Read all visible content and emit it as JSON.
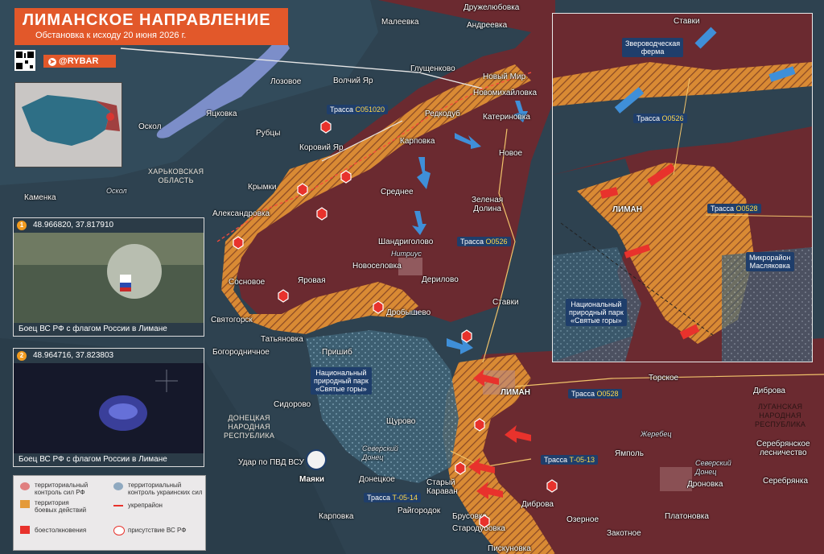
{
  "header": {
    "title": "ЛИМАНСКОЕ НАПРАВЛЕНИЕ",
    "subtitle": "Обстановка к исходу 20 июня 2026 г.",
    "brand": "@RYBAR"
  },
  "colors": {
    "russian_control": "#6b2a30",
    "contested": "#e49a3a",
    "ukrainian_control": "#2f4a5a",
    "river": "#7c8ec9",
    "accent": "#e2582a",
    "road_label_bg": "#1f3e6b",
    "road_code": "#ffd94a"
  },
  "minimap": {
    "city": "Оскол"
  },
  "place_labels": [
    {
      "id": "maleevka",
      "text": "Малеевка"
    },
    {
      "id": "druzhelyubovka",
      "text": "Дружелюбовка"
    },
    {
      "id": "andreevka",
      "text": "Андреевка"
    },
    {
      "id": "glushchenkovo",
      "text": "Глущенково"
    },
    {
      "id": "lozovoe",
      "text": "Лозовое"
    },
    {
      "id": "volchiy-yar",
      "text": "Волчий Яр"
    },
    {
      "id": "novy-mir",
      "text": "Новый Мир"
    },
    {
      "id": "novomikhaylovka",
      "text": "Новомихайловка"
    },
    {
      "id": "yatskovka",
      "text": "Яцковка"
    },
    {
      "id": "oskol",
      "text": "Оскол"
    },
    {
      "id": "rubtsy",
      "text": "Рубцы"
    },
    {
      "id": "redkodub",
      "text": "Редкодуб"
    },
    {
      "id": "katerinovka",
      "text": "Катериновка"
    },
    {
      "id": "karpovka",
      "text": "Карповка"
    },
    {
      "id": "novoe",
      "text": "Новое"
    },
    {
      "id": "korovy-yar",
      "text": "Коровий Яр"
    },
    {
      "id": "krymki",
      "text": "Крымки"
    },
    {
      "id": "kamenka",
      "text": "Каменка"
    },
    {
      "id": "oskol-river",
      "text": "Оскол"
    },
    {
      "id": "srednee",
      "text": "Среднее"
    },
    {
      "id": "zelenaya-dolina",
      "text": "Зеленая\nДолина"
    },
    {
      "id": "aleksandrovka",
      "text": "Александровка"
    },
    {
      "id": "shandrigolovo",
      "text": "Шандриголово"
    },
    {
      "id": "nitrius",
      "text": "Нитриус"
    },
    {
      "id": "novoselovka",
      "text": "Новоселовка"
    },
    {
      "id": "derilovo",
      "text": "Дерилово"
    },
    {
      "id": "sosnovoe",
      "text": "Сосновое"
    },
    {
      "id": "yarovaya",
      "text": "Яровая"
    },
    {
      "id": "stavki",
      "text": "Ставки"
    },
    {
      "id": "svyatogorsk",
      "text": "Святогорск"
    },
    {
      "id": "drobyshevo",
      "text": "Дробышево"
    },
    {
      "id": "tatyanovka",
      "text": "Татьяновка"
    },
    {
      "id": "bogorodnichnoe",
      "text": "Богородничное"
    },
    {
      "id": "prishib",
      "text": "Пришиб"
    },
    {
      "id": "liman",
      "text": "ЛИМАН"
    },
    {
      "id": "torskoe",
      "text": "Торское"
    },
    {
      "id": "dibrova-e",
      "text": "Диброва"
    },
    {
      "id": "sidorovo",
      "text": "Сидорово"
    },
    {
      "id": "shchurovo",
      "text": "Щурово"
    },
    {
      "id": "zherebets",
      "text": "Жеребец"
    },
    {
      "id": "seversky-donets",
      "text": "Северский\nДонец"
    },
    {
      "id": "yampol",
      "text": "Ямполь"
    },
    {
      "id": "seversky-donets-e",
      "text": "Северский\nДонец"
    },
    {
      "id": "serebryanskoe",
      "text": "Серебрянское\nлесничество"
    },
    {
      "id": "mayaki",
      "text": "Маяки"
    },
    {
      "id": "donetskoe",
      "text": "Донецкое"
    },
    {
      "id": "stary-karavan",
      "text": "Старый\nКараван"
    },
    {
      "id": "dronovka",
      "text": "Дроновка"
    },
    {
      "id": "serebryanka",
      "text": "Серебрянка"
    },
    {
      "id": "raygorodok",
      "text": "Райгородок"
    },
    {
      "id": "brusovka",
      "text": "Брусовка"
    },
    {
      "id": "dibrova",
      "text": "Диброва"
    },
    {
      "id": "platonovka",
      "text": "Платоновка"
    },
    {
      "id": "karpovka-s",
      "text": "Карповка"
    },
    {
      "id": "starodubovka",
      "text": "Стародубовка"
    },
    {
      "id": "ozernoe",
      "text": "Озерное"
    },
    {
      "id": "zakotnoe",
      "text": "Закотное"
    },
    {
      "id": "piskunovka",
      "text": "Пискуновка"
    }
  ],
  "regions": {
    "kharkov": "ХАРЬКОВСКАЯ\nОБЛАСТЬ",
    "dnr": "ДОНЕЦКАЯ\nНАРОДНАЯ\nРЕСПУБЛИКА",
    "lnr": "ЛУГАНСКАЯ\nНАРОДНАЯ\nРЕСПУБЛИКА"
  },
  "roads": [
    {
      "id": "c051020",
      "prefix": "Трасса",
      "code": "С051020"
    },
    {
      "id": "o0526",
      "prefix": "Трасса",
      "code": "О0526"
    },
    {
      "id": "o0528",
      "prefix": "Трасса",
      "code": "О0528"
    },
    {
      "id": "t0513",
      "prefix": "Трасса",
      "code": "Т-05-13"
    },
    {
      "id": "t0514",
      "prefix": "Трасса",
      "code": "Т-05-14"
    }
  ],
  "park_label": "Национальный\nприродный парк\n«Святые горы»",
  "strike_label": "Удар по ПВД ВСУ",
  "photo_panels": [
    {
      "coords": "48.966820, 37.817910",
      "num": "1",
      "caption": "Боец ВС РФ с флагом России в Лимане"
    },
    {
      "coords": "48.964716, 37.823803",
      "num": "2",
      "caption": "Боец ВС РФ с флагом России в Лимане"
    }
  ],
  "inset": {
    "stavki": "Ставки",
    "farm": "Звероводческая\nферма",
    "road_o0526": {
      "prefix": "Трасса",
      "code": "О0526"
    },
    "road_o0528": {
      "prefix": "Трасса",
      "code": "О0528"
    },
    "liman": "ЛИМАН",
    "maslyakovka": "Микрорайон\nМасляковка",
    "park": "Национальный\nприродный парк\n«Святые горы»"
  },
  "legend": {
    "ru_control": "территориальный\nконтроль сил РФ",
    "ua_control": "территориальный\nконтроль украинских сил",
    "contested": "территория\nбоевых действий",
    "fortline": "укрепрайон",
    "clashes": "боестолкновения",
    "ru_presence": "присутствие ВС РФ"
  }
}
